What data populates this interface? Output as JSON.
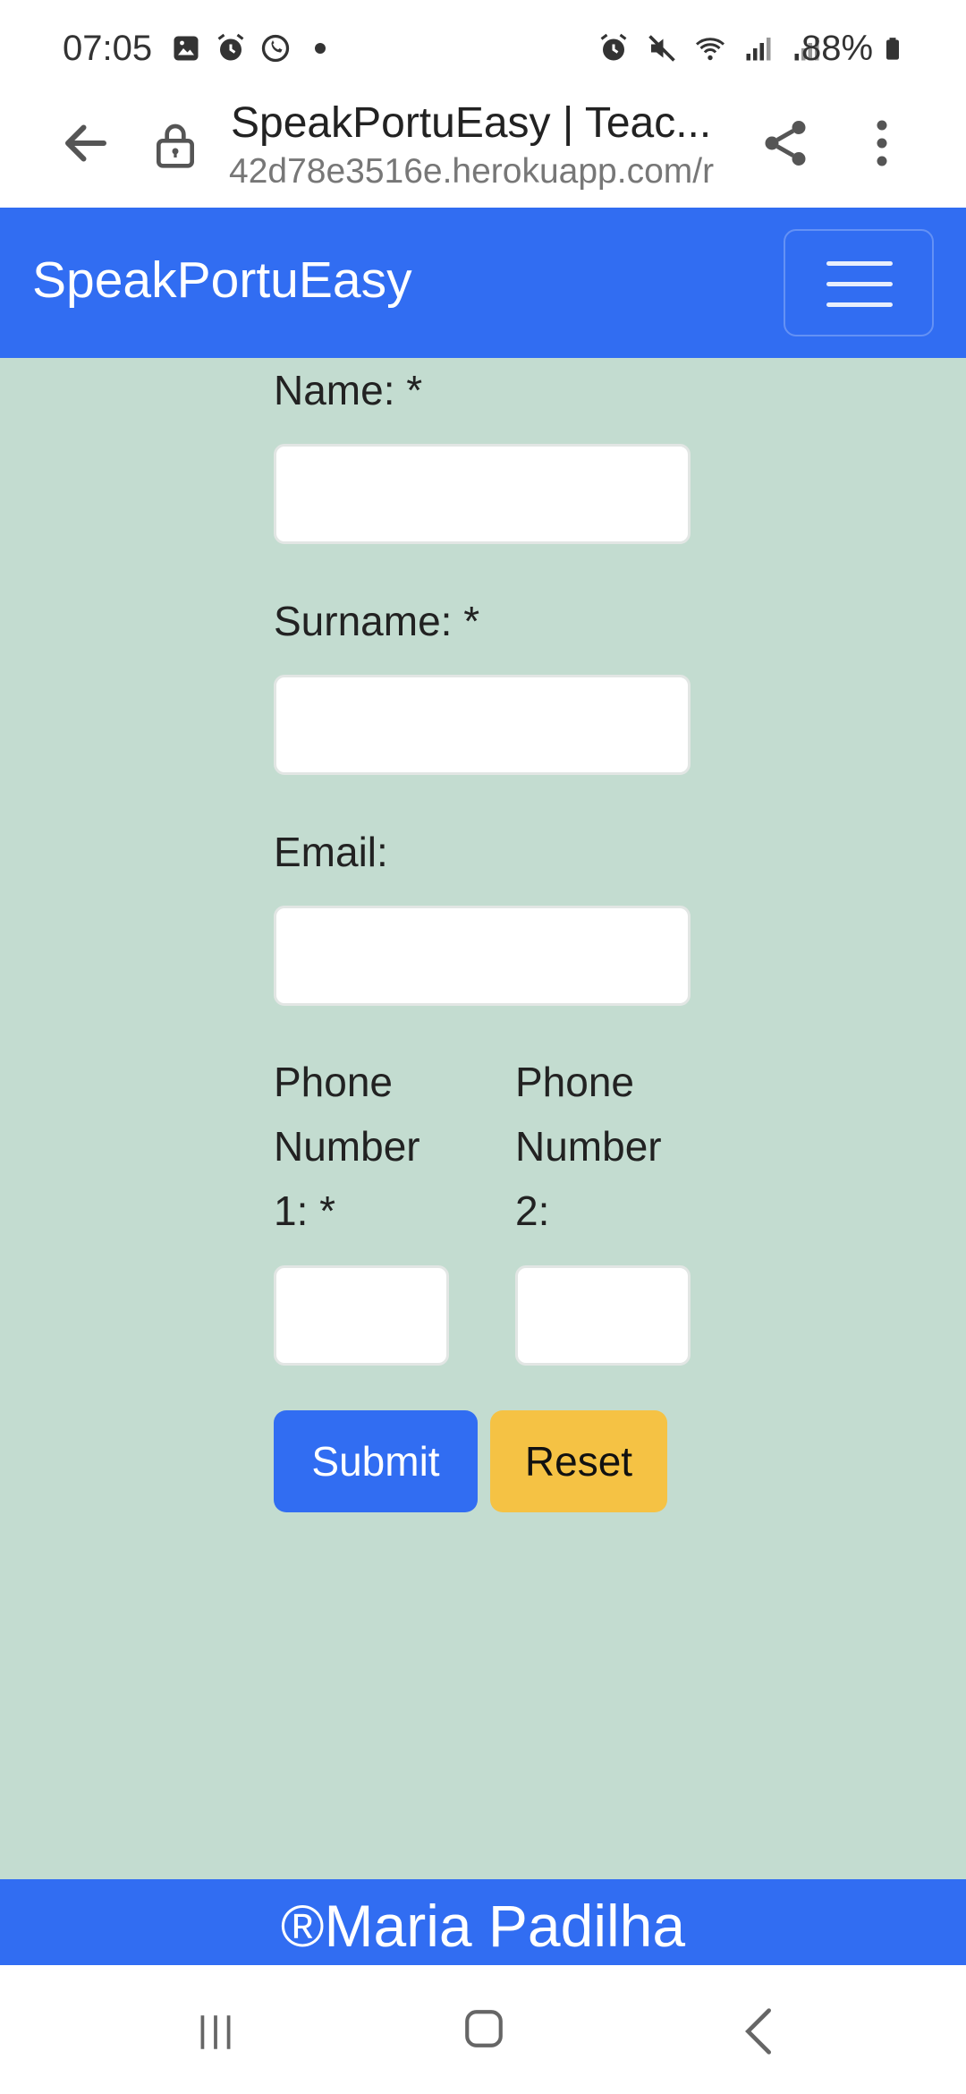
{
  "status_bar": {
    "time": "07:05",
    "battery": "88%"
  },
  "browser": {
    "title": "SpeakPortuEasy | Teac...",
    "url": "42d78e3516e.herokuapp.com/r"
  },
  "navbar": {
    "brand": "SpeakPortuEasy"
  },
  "form": {
    "name_label": "Name: *",
    "surname_label": "Surname: *",
    "email_label": "Email:",
    "phone1_label_line1": "Phone",
    "phone1_label_line2": "Number",
    "phone1_label_line3": "1: *",
    "phone2_label_line1": "Phone",
    "phone2_label_line2": "Number",
    "phone2_label_line3": "2:",
    "submit_label": "Submit",
    "reset_label": "Reset"
  },
  "footer": {
    "text": "®Maria Padilha"
  },
  "colors": {
    "primary": "#316df2",
    "background": "#c3dcd0",
    "reset": "#f5c244"
  }
}
